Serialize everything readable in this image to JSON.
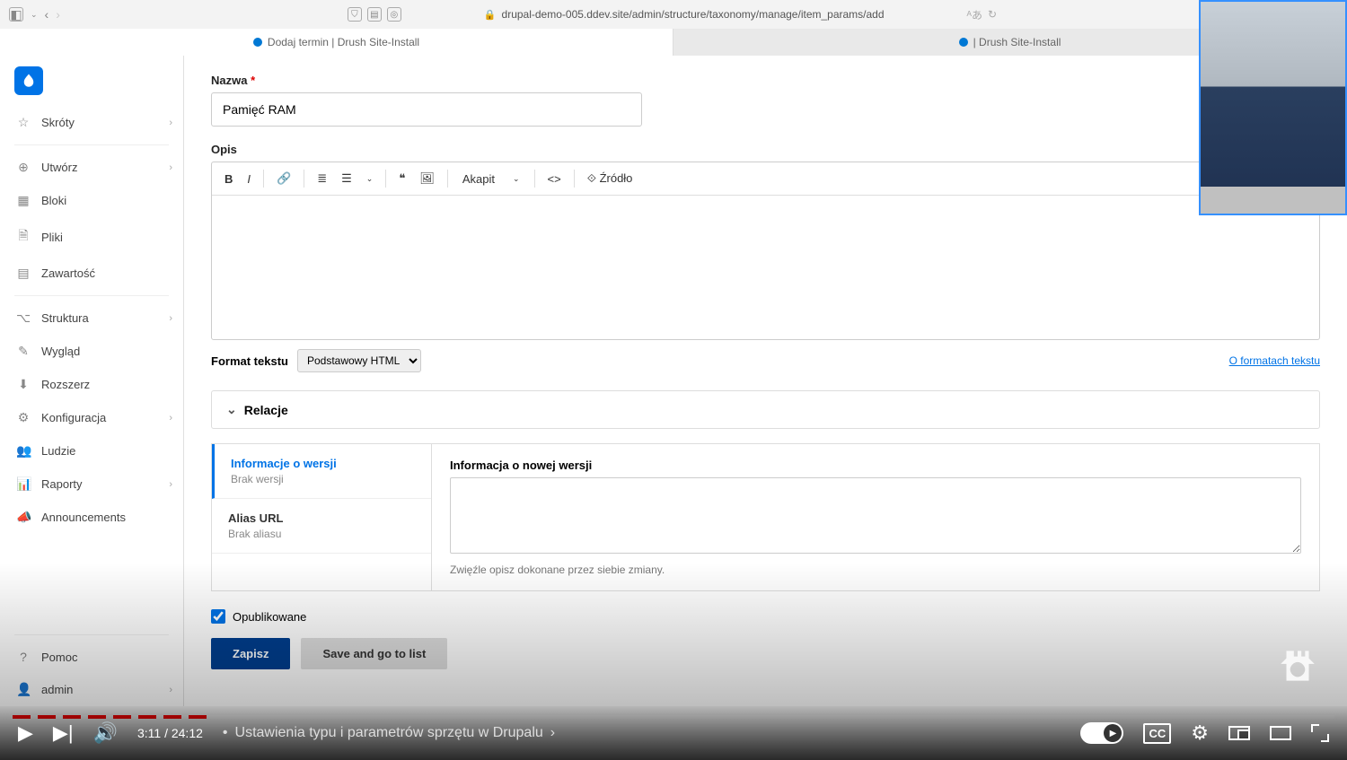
{
  "browser": {
    "url": "drupal-demo-005.ddev.site/admin/structure/taxonomy/manage/item_params/add",
    "tabs": [
      {
        "title": "Dodaj termin | Drush Site-Install"
      },
      {
        "title": "| Drush Site-Install"
      }
    ]
  },
  "sidebar": {
    "items": [
      {
        "icon": "star",
        "label": "Skróty",
        "chev": true
      },
      {
        "icon": "plus-circle",
        "label": "Utwórz",
        "chev": true
      },
      {
        "icon": "grid",
        "label": "Bloki"
      },
      {
        "icon": "file",
        "label": "Pliki"
      },
      {
        "icon": "doc",
        "label": "Zawartość"
      },
      {
        "icon": "branch",
        "label": "Struktura",
        "chev": true
      },
      {
        "icon": "brush",
        "label": "Wygląd"
      },
      {
        "icon": "download",
        "label": "Rozszerz"
      },
      {
        "icon": "sliders",
        "label": "Konfiguracja",
        "chev": true
      },
      {
        "icon": "people",
        "label": "Ludzie"
      },
      {
        "icon": "chart",
        "label": "Raporty",
        "chev": true
      },
      {
        "icon": "megaphone",
        "label": "Announcements"
      }
    ],
    "bottom": [
      {
        "icon": "help",
        "label": "Pomoc"
      },
      {
        "icon": "user",
        "label": "admin",
        "chev": true
      }
    ]
  },
  "form": {
    "name_label": "Nazwa",
    "name_value": "Pamięć RAM",
    "desc_label": "Opis",
    "editor": {
      "paragraph": "Akapit",
      "source": "Źródło"
    },
    "format_label": "Format tekstu",
    "format_value": "Podstawowy HTML",
    "format_link": "O formatach tekstu",
    "relations_label": "Relacje",
    "vtabs": {
      "revision": {
        "title": "Informacje o wersji",
        "sub": "Brak wersji"
      },
      "alias": {
        "title": "Alias URL",
        "sub": "Brak aliasu"
      },
      "log_label": "Informacja o nowej wersji",
      "log_help": "Zwięźle opisz dokonane przez siebie zmiany."
    },
    "published_label": "Opublikowane",
    "save": "Zapisz",
    "save_list": "Save and go to list"
  },
  "player": {
    "current": "3:11",
    "total": "24:12",
    "chapter": "Ustawienia typu i parametrów sprzętu w Drupalu"
  }
}
